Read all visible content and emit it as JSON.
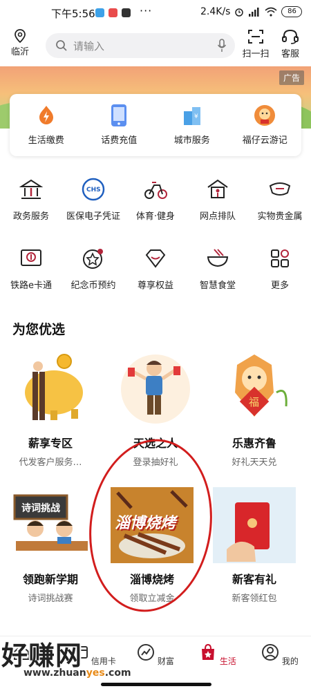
{
  "status_bar": {
    "time": "下午5:56",
    "speed": "2.4K/s",
    "battery": "86"
  },
  "header": {
    "location": "临沂",
    "search_placeholder": "请输入",
    "scan_label": "扫一扫",
    "service_label": "客服"
  },
  "banner": {
    "ad_label": "广告"
  },
  "services": [
    {
      "label": "生活缴费",
      "icon": "flame-icon"
    },
    {
      "label": "话费充值",
      "icon": "phone-icon"
    },
    {
      "label": "城市服务",
      "icon": "city-icon"
    },
    {
      "label": "福仔云游记",
      "icon": "mascot-icon"
    }
  ],
  "grid_row1": [
    {
      "label": "政务服务",
      "icon": "government-icon"
    },
    {
      "label": "医保电子凭证",
      "icon": "chs-icon"
    },
    {
      "label": "体育·健身",
      "icon": "bike-icon"
    },
    {
      "label": "网点排队",
      "icon": "bank-queue-icon"
    },
    {
      "label": "实物贵金属",
      "icon": "gold-icon"
    }
  ],
  "grid_row2": [
    {
      "label": "铁路e卡通",
      "icon": "railway-icon"
    },
    {
      "label": "纪念币预约",
      "icon": "coin-icon"
    },
    {
      "label": "尊享权益",
      "icon": "diamond-icon"
    },
    {
      "label": "智慧食堂",
      "icon": "bowl-icon"
    },
    {
      "label": "更多",
      "icon": "more-grid-icon"
    }
  ],
  "section_title": "为您优选",
  "promos": [
    {
      "title": "薪享专区",
      "subtitle": "代发客户服务…"
    },
    {
      "title": "天选之人",
      "subtitle": "登录抽好礼"
    },
    {
      "title": "乐惠齐鲁",
      "subtitle": "好礼天天兑"
    },
    {
      "title": "领跑新学期",
      "subtitle": "诗词挑战赛",
      "pic_text": "诗词挑战"
    },
    {
      "title": "淄博烧烤",
      "subtitle": "领取立减金",
      "pic_text": "淄博烧烤"
    },
    {
      "title": "新客有礼",
      "subtitle": "新客领红包"
    }
  ],
  "tabs": [
    {
      "label": "首页",
      "icon": "home-icon"
    },
    {
      "label": "信用卡",
      "icon": "card-icon"
    },
    {
      "label": "财富",
      "icon": "chart-icon"
    },
    {
      "label": "生活",
      "icon": "shopping-bag-icon",
      "active": true
    },
    {
      "label": "我的",
      "icon": "user-icon"
    }
  ],
  "watermark": {
    "text": "好赚网",
    "url_prefix": "www.zhuan",
    "url_mid": "yes",
    "url_suffix": ".com"
  },
  "colors": {
    "accent": "#c8102e",
    "icon_red": "#b2253b"
  }
}
